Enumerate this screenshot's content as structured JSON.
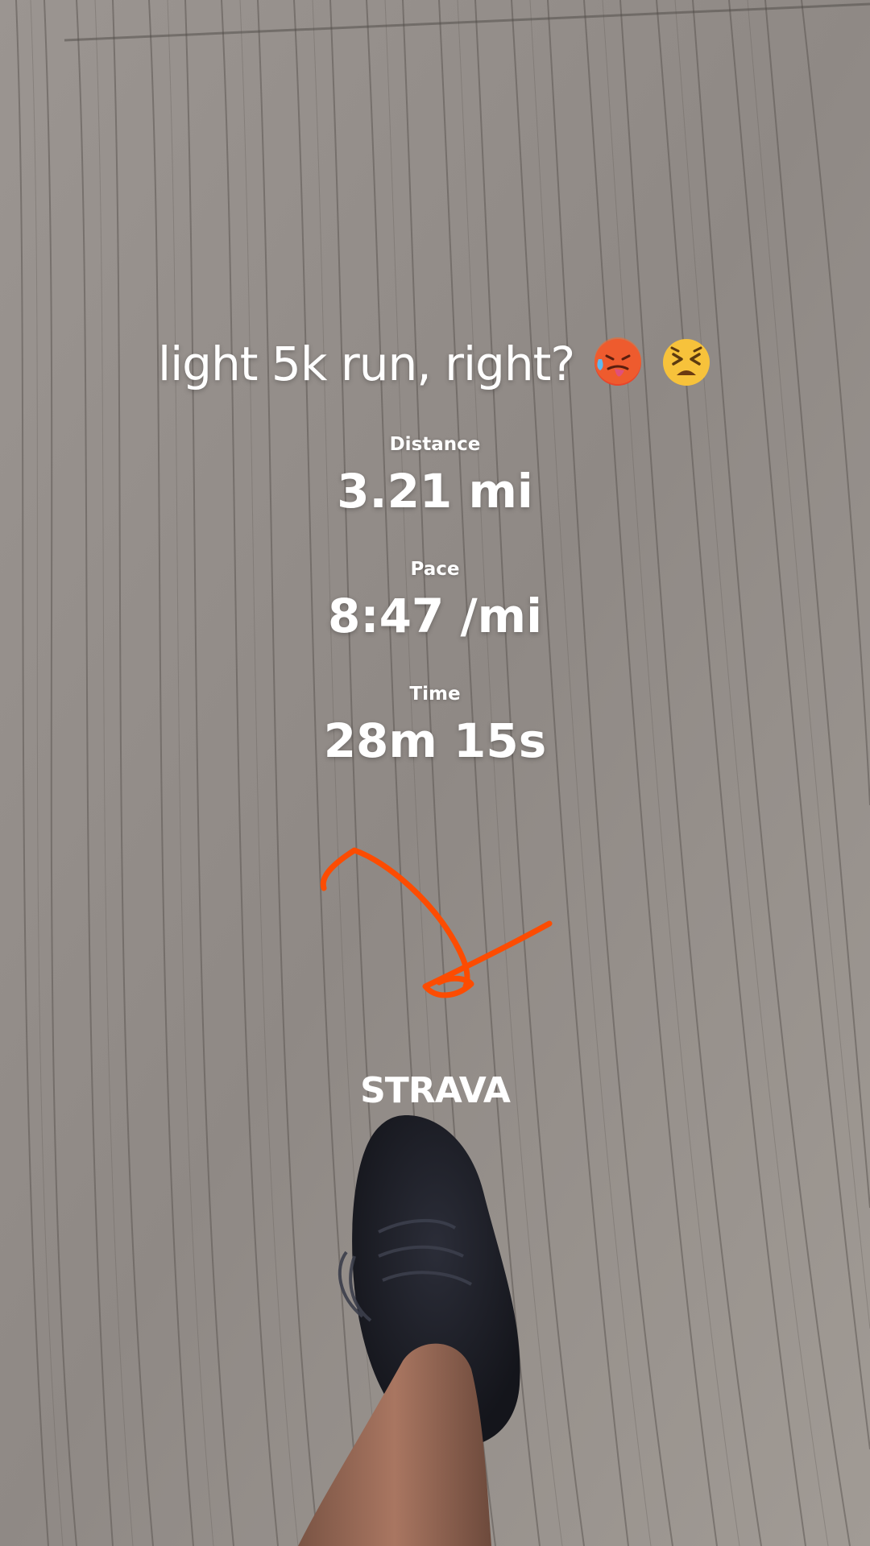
{
  "story": {
    "caption": "light 5k run, right?",
    "caption_emojis": [
      "hot-face",
      "tired-face"
    ],
    "logo_text": "STRAVA",
    "accent_color": "#fc4c02"
  },
  "stats": [
    {
      "label": "Distance",
      "value": "3.21 mi"
    },
    {
      "label": "Pace",
      "value": "8:47 /mi"
    },
    {
      "label": "Time",
      "value": "28m 15s"
    }
  ]
}
